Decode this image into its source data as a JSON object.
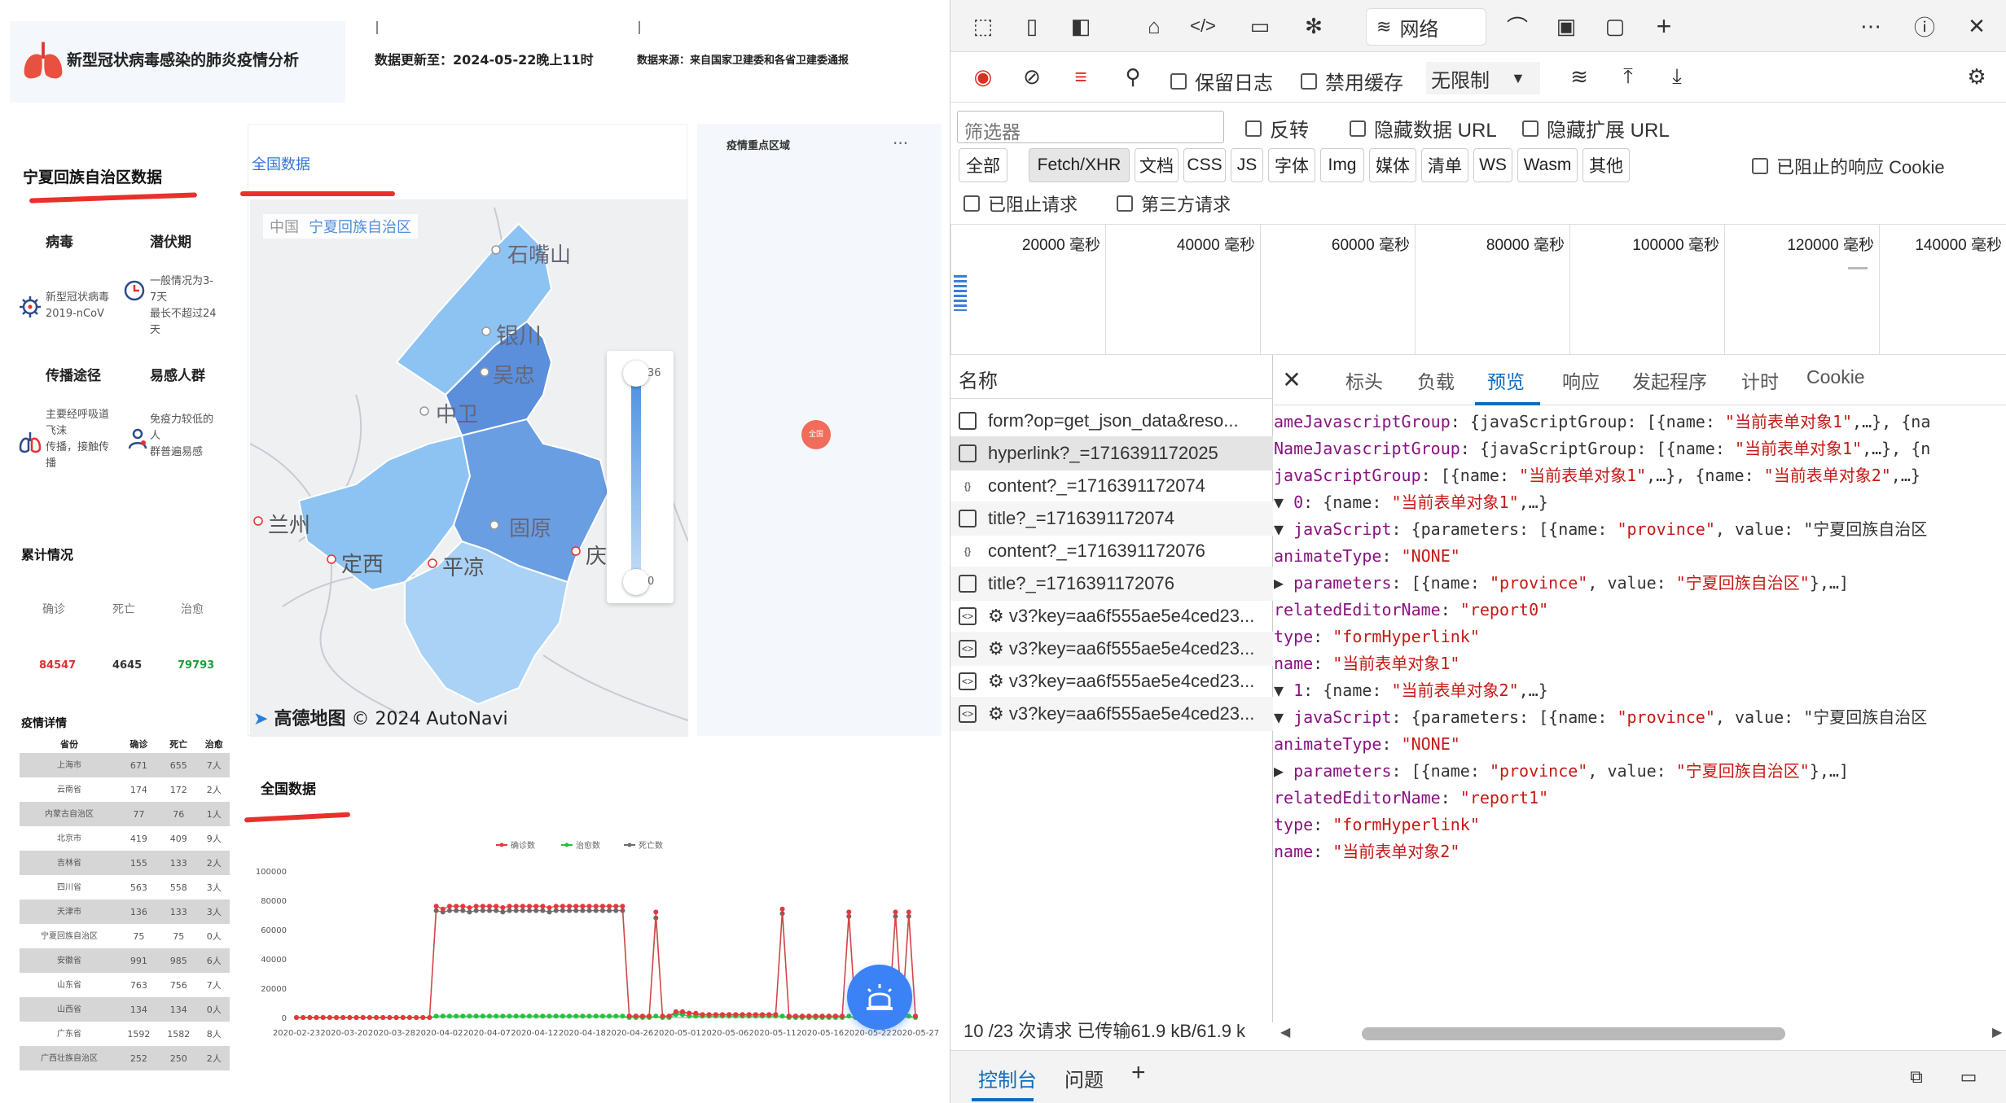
{
  "dashboard": {
    "title": "新型冠状病毒感染的肺炎疫情分析",
    "update_label": "数据更新至：2024-05-22晚上11时",
    "source_label": "数据来源：来自国家卫建委和各省卫建委通报",
    "region_title": "宁夏回族自治区数据",
    "virus_label": "病毒",
    "virus_text": "新型冠状病毒\n2019-nCoV",
    "incubation_label": "潜伏期",
    "incubation_text": "一般情况为3-\n7天\n最长不超过24\n天",
    "route_label": "传播途径",
    "route_text": "主要经呼吸道\n飞沫\n传播，接触传\n播",
    "susceptible_label": "易感人群",
    "susceptible_text": "免疫力较低的\n人\n群普遍易感",
    "cumulative_title": "累计情况",
    "stats": [
      {
        "label": "确诊",
        "value": "84547",
        "color": "#e02f2f"
      },
      {
        "label": "死亡",
        "value": "4645",
        "color": "#333333"
      },
      {
        "label": "治愈",
        "value": "79793",
        "color": "#1e9e3a"
      }
    ],
    "detail_title": "疫情详情",
    "detail_headers": [
      "省份",
      "确诊",
      "死亡",
      "治愈"
    ],
    "detail_rows": [
      [
        "上海市",
        "671",
        "655",
        "7人"
      ],
      [
        "云南省",
        "174",
        "172",
        "2人"
      ],
      [
        "内蒙古自治区",
        "77",
        "76",
        "1人"
      ],
      [
        "北京市",
        "419",
        "409",
        "9人"
      ],
      [
        "吉林省",
        "155",
        "133",
        "2人"
      ],
      [
        "四川省",
        "563",
        "558",
        "3人"
      ],
      [
        "天津市",
        "136",
        "133",
        "3人"
      ],
      [
        "宁夏回族自治区",
        "75",
        "75",
        "0人"
      ],
      [
        "安徽省",
        "991",
        "985",
        "6人"
      ],
      [
        "山东省",
        "763",
        "756",
        "7人"
      ],
      [
        "山西省",
        "134",
        "134",
        "0人"
      ],
      [
        "广东省",
        "1592",
        "1582",
        "8人"
      ],
      [
        "广西壮族自治区",
        "252",
        "250",
        "2人"
      ]
    ],
    "map_tab": "全国数据",
    "breadcrumb_root": "中国",
    "breadcrumb_region": "宁夏回族自治区",
    "map_cities": [
      "石嘴山",
      "银川",
      "吴忠",
      "中卫",
      "固原",
      "兰州",
      "定西",
      "平凉",
      "庆阳"
    ],
    "legend_max": "36",
    "legend_min": "0",
    "map_credit_brand": "高德地图",
    "map_credit_text": "© 2024 AutoNavi",
    "hot_title": "疫情重点区域",
    "hot_more": "···",
    "hot_marker": "全国",
    "chart_title": "全国数据"
  },
  "chart_data": {
    "type": "line",
    "title": "",
    "xlabel": "",
    "ylabel": "",
    "ylim": [
      0,
      100000
    ],
    "yticks": [
      "0",
      "20000",
      "40000",
      "60000",
      "80000",
      "100000"
    ],
    "xticks": [
      "2020-02-23",
      "2020-03-20",
      "2020-03-28",
      "2020-04-02",
      "2020-04-07",
      "2020-04-12",
      "2020-04-18",
      "2020-04-26",
      "2020-05-01",
      "2020-05-06",
      "2020-05-11",
      "2020-05-16",
      "2020-05-22",
      "2020-05-27"
    ],
    "legend": [
      "确诊数",
      "治愈数",
      "死亡数"
    ],
    "legend_placement": "top-center",
    "series": [
      {
        "name": "确诊数",
        "color": "#e4393c",
        "values": [
          0,
          0,
          0,
          0,
          0,
          0,
          0,
          0,
          0,
          0,
          0,
          0,
          0,
          0,
          0,
          0,
          0,
          0,
          0,
          0,
          0,
          76000,
          74000,
          76000,
          76000,
          76000,
          75000,
          76000,
          76000,
          76000,
          76000,
          75000,
          76000,
          76000,
          76000,
          76000,
          76000,
          76000,
          75000,
          76000,
          76000,
          76000,
          76000,
          76000,
          76000,
          76000,
          76000,
          76000,
          76000,
          76000,
          1000,
          1000,
          1000,
          1000,
          72000,
          1000,
          1000,
          4000,
          4000,
          3000,
          3000,
          2000,
          2000,
          2000,
          2000,
          2000,
          2000,
          2000,
          2000,
          2000,
          2000,
          2000,
          2000,
          74000,
          1000,
          1000,
          1000,
          1000,
          1000,
          1000,
          1000,
          1000,
          1000,
          72000,
          1000,
          1000,
          1000,
          2000,
          1000,
          1000,
          72000,
          1000,
          72000,
          1000
        ]
      },
      {
        "name": "治愈数",
        "color": "#22c33a",
        "values": [
          0,
          0,
          0,
          0,
          0,
          0,
          0,
          0,
          0,
          0,
          0,
          0,
          0,
          0,
          0,
          0,
          0,
          0,
          0,
          0,
          0,
          1000,
          1000,
          1000,
          1000,
          1000,
          1000,
          1000,
          1000,
          1000,
          1000,
          1000,
          1000,
          1000,
          1000,
          1000,
          1000,
          1000,
          1000,
          1000,
          1000,
          1000,
          1000,
          1000,
          1000,
          1000,
          1000,
          1000,
          1000,
          1000,
          0,
          0,
          0,
          0,
          1000,
          0,
          0,
          2000,
          2000,
          1000,
          1000,
          1000,
          1000,
          1000,
          1000,
          1000,
          1000,
          1000,
          1000,
          1000,
          1000,
          1000,
          1000,
          1000,
          0,
          0,
          0,
          0,
          0,
          0,
          0,
          0,
          0,
          1000,
          0,
          0,
          0,
          1000,
          0,
          0,
          1000,
          0,
          1000,
          0
        ]
      },
      {
        "name": "死亡数",
        "color": "#6b6b6b",
        "values": [
          0,
          0,
          0,
          0,
          0,
          0,
          0,
          0,
          0,
          0,
          0,
          0,
          0,
          0,
          0,
          0,
          0,
          0,
          0,
          0,
          0,
          73000,
          72000,
          73000,
          73000,
          73000,
          72000,
          73000,
          73000,
          73000,
          73000,
          72000,
          73000,
          73000,
          73000,
          73000,
          73000,
          73000,
          72000,
          73000,
          73000,
          73000,
          73000,
          73000,
          73000,
          73000,
          73000,
          73000,
          73000,
          73000,
          1000,
          1000,
          1000,
          1000,
          68000,
          1000,
          1000,
          3000,
          3000,
          3000,
          2000,
          2000,
          2000,
          2000,
          2000,
          2000,
          2000,
          2000,
          2000,
          2000,
          2000,
          2000,
          2000,
          71000,
          1000,
          1000,
          1000,
          1000,
          1000,
          1000,
          1000,
          1000,
          1000,
          69000,
          1000,
          1000,
          1000,
          1000,
          1000,
          1000,
          69000,
          1000,
          69000,
          1000
        ]
      }
    ]
  },
  "devtools": {
    "network_tab": "网络",
    "preserve_log": "保留日志",
    "disable_cache": "禁用缓存",
    "throttle": "无限制",
    "filter_placeholder": "筛选器",
    "invert": "反转",
    "hide_data_url": "隐藏数据 URL",
    "hide_ext_url": "隐藏扩展 URL",
    "types": [
      "全部",
      "Fetch/XHR",
      "文档",
      "CSS",
      "JS",
      "字体",
      "Img",
      "媒体",
      "清单",
      "WS",
      "Wasm",
      "其他"
    ],
    "blocked_cookie": "已阻止的响应 Cookie",
    "blocked_req": "已阻止请求",
    "third_party": "第三方请求",
    "timeline_labels": [
      "20000 毫秒",
      "40000 毫秒",
      "60000 毫秒",
      "80000 毫秒",
      "100000 毫秒",
      "120000 毫秒",
      "140000 毫秒"
    ],
    "name_header": "名称",
    "requests": [
      {
        "icon": "doc",
        "name": "form?op=get_json_data&reso..."
      },
      {
        "icon": "doc",
        "name": "hyperlink?_=1716391172025"
      },
      {
        "icon": "json",
        "name": "content?_=1716391172074"
      },
      {
        "icon": "doc",
        "name": "title?_=1716391172074"
      },
      {
        "icon": "json",
        "name": "content?_=1716391172076"
      },
      {
        "icon": "doc",
        "name": "title?_=1716391172076"
      },
      {
        "icon": "script",
        "name": "⚙ v3?key=aa6f555ae5e4ced23..."
      },
      {
        "icon": "script",
        "name": "⚙ v3?key=aa6f555ae5e4ced23..."
      },
      {
        "icon": "script",
        "name": "⚙ v3?key=aa6f555ae5e4ced23..."
      },
      {
        "icon": "script",
        "name": "⚙ v3?key=aa6f555ae5e4ced23..."
      }
    ],
    "status_line": "10 /23 次请求  已传输61.9 kB/61.9 k",
    "detail_tabs": [
      "标头",
      "负载",
      "预览",
      "响应",
      "发起程序",
      "计时",
      "Cookie"
    ],
    "preview_lines": [
      "ameJavascriptGroup: {javaScriptGroup: [{name: \"当前表单对象1\",…}, {na",
      "NameJavascriptGroup: {javaScriptGroup: [{name: \"当前表单对象1\",…}, {n",
      "javaScriptGroup: [{name: \"当前表单对象1\",…}, {name: \"当前表单对象2\",…}",
      "▼ 0: {name: \"当前表单对象1\",…}",
      "  ▼ javaScript: {parameters: [{name: \"province\", value: \"宁夏回族自治区",
      "      animateType: \"NONE\"",
      "    ▶ parameters: [{name: \"province\", value: \"宁夏回族自治区\"},…]",
      "      relatedEditorName: \"report0\"",
      "      type: \"formHyperlink\"",
      "    name: \"当前表单对象1\"",
      "▼ 1: {name: \"当前表单对象2\",…}",
      "  ▼ javaScript: {parameters: [{name: \"province\", value: \"宁夏回族自治区",
      "      animateType: \"NONE\"",
      "    ▶ parameters: [{name: \"province\", value: \"宁夏回族自治区\"},…]",
      "      relatedEditorName: \"report1\"",
      "      type: \"formHyperlink\"",
      "    name: \"当前表单对象2\""
    ],
    "drawer_console": "控制台",
    "drawer_issues": "问题"
  }
}
